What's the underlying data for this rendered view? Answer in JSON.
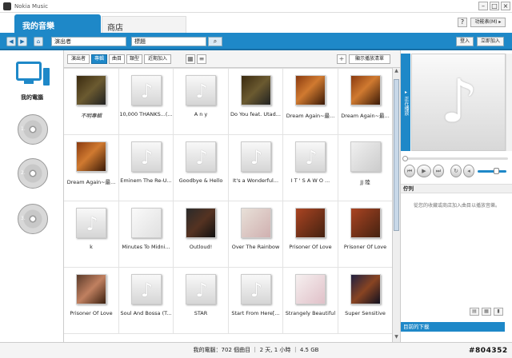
{
  "window": {
    "title": "Nokia Music"
  },
  "tabs": [
    {
      "label": "我的音樂"
    },
    {
      "label": "商店"
    }
  ],
  "header": {
    "help_label": "?",
    "activity_label": "功能表(M) ▸"
  },
  "toolbar": {
    "artist_value": "演出者",
    "title_value": "標題",
    "login_label": "登入",
    "signup_label": "立即加入"
  },
  "sidebar": {
    "pc_label": "我的電腦",
    "discs": [
      "1.",
      "2.",
      "3."
    ]
  },
  "view_tabs": [
    {
      "label": "演出者",
      "active": false
    },
    {
      "label": "專輯",
      "active": true
    },
    {
      "label": "曲目",
      "active": false
    },
    {
      "label": "類型",
      "active": false
    },
    {
      "label": "近期加入",
      "active": false
    }
  ],
  "view": {
    "add_label": "+",
    "show_playlist_label": "顯示播放清單"
  },
  "albums": [
    {
      "title": "不明專輯",
      "cover": "c1"
    },
    {
      "title": "10,000 THANKS...(...",
      "cover": "gen"
    },
    {
      "title": "A n y",
      "cover": "gen"
    },
    {
      "title": "Do You feat. Utad...",
      "cover": "c1"
    },
    {
      "title": "Dream Again~最...",
      "cover": "c2"
    },
    {
      "title": "Dream Again~最...",
      "cover": "c2"
    },
    {
      "title": "Dream Again~最...",
      "cover": "c2"
    },
    {
      "title": "Eminem The Re-U...",
      "cover": "gen"
    },
    {
      "title": "Goodbye & Hello",
      "cover": "gen"
    },
    {
      "title": "It's a Wonderful...",
      "cover": "gen"
    },
    {
      "title": "I T ' S A W O ...",
      "cover": "gen"
    },
    {
      "title": "JJ 陸",
      "cover": "c3"
    },
    {
      "title": "k",
      "cover": "gen"
    },
    {
      "title": "Minutes To Midni...",
      "cover": "c7"
    },
    {
      "title": "Outloud!",
      "cover": "c4"
    },
    {
      "title": "Over The Rainbow",
      "cover": "c5"
    },
    {
      "title": "Prisoner Of Love",
      "cover": "c6"
    },
    {
      "title": "Prisoner Of Love",
      "cover": "c6"
    },
    {
      "title": "Prisoner Of Love",
      "cover": "c8"
    },
    {
      "title": "Soul And Bossa (T...",
      "cover": "gen"
    },
    {
      "title": "STAR",
      "cover": "gen"
    },
    {
      "title": "Start From Here[...",
      "cover": "gen"
    },
    {
      "title": "Strangely Beautiful",
      "cover": "c9"
    },
    {
      "title": "Super Sensitive",
      "cover": "c10"
    }
  ],
  "player": {
    "now_playing_label": "▸ 正在播放",
    "queue_header": "佇列",
    "queue_empty": "從您的收藏或商店加入曲目以播放音樂。",
    "downloads_label": "目前的下載"
  },
  "status": {
    "text": "我的電腦：702 個曲目 ｜ 2 天, 1 小時 ｜ 4.5 GB"
  },
  "watermark": "#804352"
}
